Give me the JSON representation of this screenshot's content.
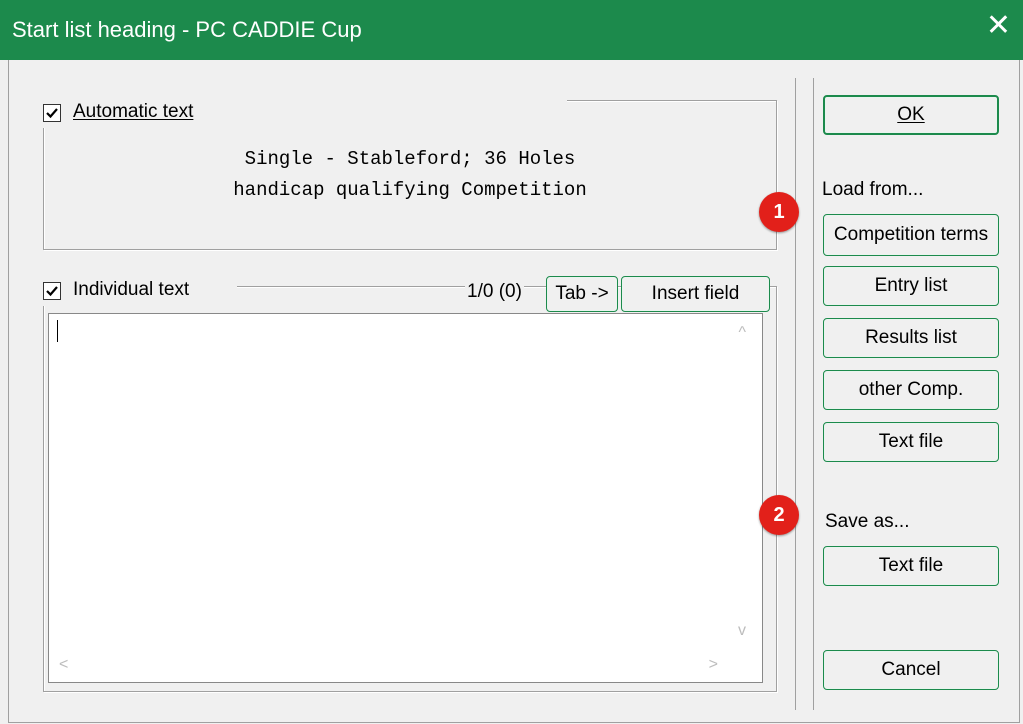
{
  "window": {
    "title": "Start list heading - PC CADDIE Cup",
    "close_glyph": "✕"
  },
  "automatic": {
    "label": "Automatic text",
    "line1": "Single - Stableford; 36 Holes",
    "line2": "handicap qualifying Competition",
    "checked": true
  },
  "individual": {
    "label": "Individual text",
    "counter": "1/0 (0)",
    "tab_button": "Tab ->",
    "insert_button": "Insert field",
    "checked": true,
    "value": ""
  },
  "buttons": {
    "ok": "OK",
    "load_label": "Load from...",
    "competition_terms": "Competition terms",
    "entry_list": "Entry list",
    "results_list": "Results list",
    "other_comp": "other Comp.",
    "text_file_load": "Text file",
    "save_label": "Save as...",
    "text_file_save": "Text file",
    "cancel": "Cancel"
  },
  "badges": {
    "one": "1",
    "two": "2"
  },
  "colors": {
    "titlebar": "#1c8a4c",
    "badge": "#e2201a"
  }
}
